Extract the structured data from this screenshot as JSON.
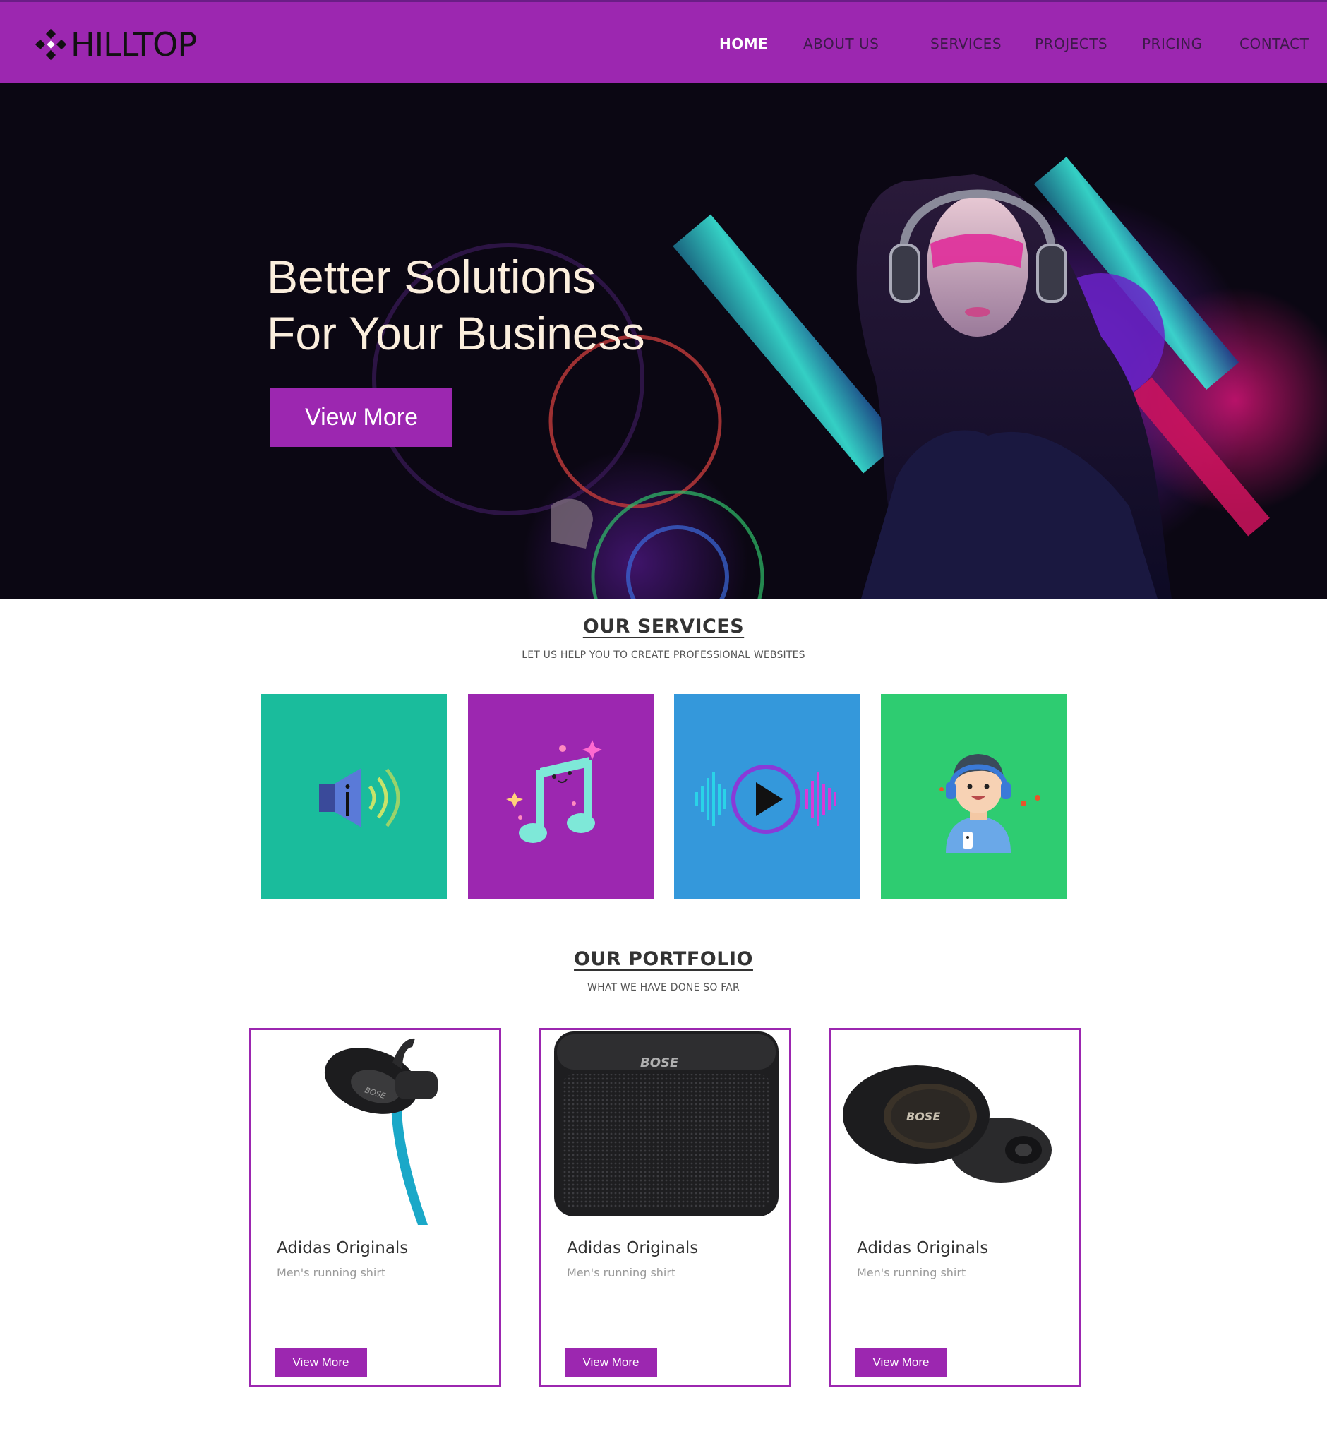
{
  "brand": {
    "name": "HILLTOP",
    "icon": "diamond-cluster-icon"
  },
  "nav": {
    "items": [
      {
        "label": "HOME",
        "active": true
      },
      {
        "label": "ABOUT US",
        "active": false
      },
      {
        "label": "SERVICES",
        "active": false
      },
      {
        "label": "PROJECTS",
        "active": false
      },
      {
        "label": "PRICING",
        "active": false
      },
      {
        "label": "CONTACT",
        "active": false
      }
    ]
  },
  "hero": {
    "title_line1": "Better Solutions",
    "title_line2": "For Your Business",
    "button_label": "View More",
    "image": "dj-girl-with-headphones-neon-illustration"
  },
  "services": {
    "title": "OUR SERVICES",
    "subtitle": "LET US HELP YOU TO CREATE PROFESSIONAL WEBSITES",
    "tiles": [
      {
        "icon": "speaker-icon",
        "color": "#1abc9c"
      },
      {
        "icon": "music-note-icon",
        "color": "#9c27b0"
      },
      {
        "icon": "audio-play-icon",
        "color": "#3498db"
      },
      {
        "icon": "listener-avatar-icon",
        "color": "#2ecc71"
      }
    ]
  },
  "portfolio": {
    "title": "OUR PORTFOLIO",
    "subtitle": "WHAT WE HAVE DONE SO FAR",
    "items": [
      {
        "image": "wireless-earbud-product",
        "name": "Adidas Originals",
        "desc": "Men's running shirt",
        "button_label": "View More"
      },
      {
        "image": "bluetooth-speaker-product",
        "name": "Adidas Originals",
        "desc": "Men's running shirt",
        "button_label": "View More"
      },
      {
        "image": "true-wireless-earbuds-product",
        "name": "Adidas Originals",
        "desc": "Men's running shirt",
        "button_label": "View More"
      }
    ]
  },
  "colors": {
    "accent": "#9c27b0",
    "hero_bg": "#0b0713",
    "hero_text": "#fbeedd"
  }
}
